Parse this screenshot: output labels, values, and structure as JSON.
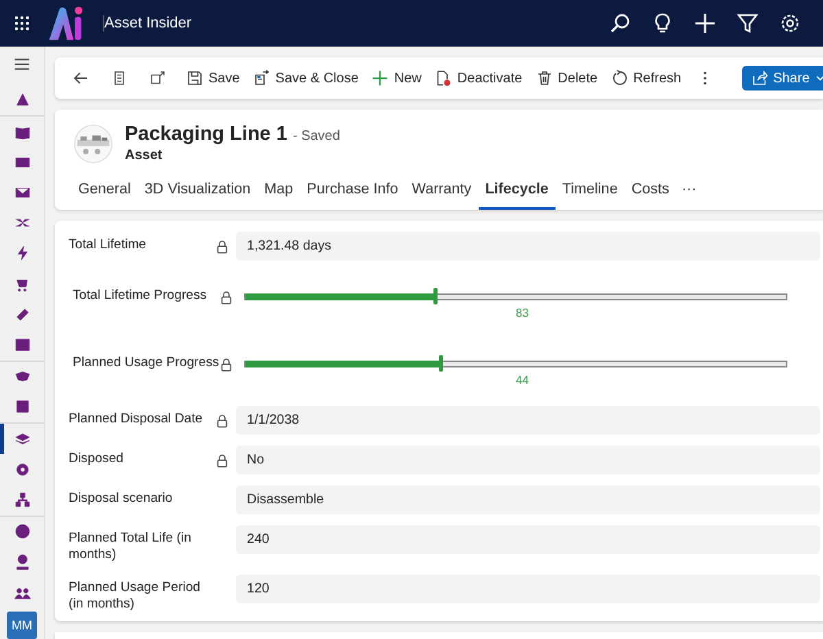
{
  "app": {
    "title": "Asset Insider"
  },
  "sidebar": {
    "items": [
      {
        "selected": false
      },
      {
        "selected": false
      },
      {
        "selected": false
      },
      {
        "selected": false
      },
      {
        "selected": false
      },
      {
        "selected": false
      },
      {
        "selected": false
      },
      {
        "selected": false
      },
      {
        "selected": false
      },
      {
        "selected": false
      },
      {
        "selected": false
      },
      {
        "selected": true
      },
      {
        "selected": false
      },
      {
        "selected": false
      },
      {
        "selected": false
      },
      {
        "selected": false
      },
      {
        "selected": false
      }
    ],
    "user": {
      "initials": "MM"
    }
  },
  "toolbar": {
    "buttons": [
      {
        "kind": "save",
        "label": "Save"
      },
      {
        "kind": "save-close",
        "label": "Save & Close"
      },
      {
        "kind": "new",
        "label": "New"
      },
      {
        "kind": "deactivate",
        "label": "Deactivate"
      },
      {
        "kind": "delete",
        "label": "Delete"
      },
      {
        "kind": "refresh",
        "label": "Refresh"
      }
    ],
    "share": "Share"
  },
  "record": {
    "title": "Packaging Line 1",
    "status": "- Saved",
    "entity": "Asset"
  },
  "tabs": [
    {
      "label": "General",
      "selected": false
    },
    {
      "label": "3D Visualization",
      "selected": false
    },
    {
      "label": "Map",
      "selected": false
    },
    {
      "label": "Purchase Info",
      "selected": false
    },
    {
      "label": "Warranty",
      "selected": false
    },
    {
      "label": "Lifecycle",
      "selected": true
    },
    {
      "label": "Timeline",
      "selected": false
    },
    {
      "label": "Costs",
      "selected": false
    }
  ],
  "tabs_more": "···",
  "fields": [
    {
      "kind": "text",
      "label": "Total Lifetime",
      "locked": true,
      "value": "1,321.48 days"
    },
    {
      "kind": "slider",
      "label": "Total Lifetime Progress",
      "locked": true,
      "level": 0.35,
      "reading": "83"
    },
    {
      "kind": "slider",
      "label": "Planned Usage Progress",
      "locked": true,
      "level": 0.36,
      "reading": "44"
    },
    {
      "kind": "text",
      "label": "Planned Disposal Date",
      "locked": true,
      "value": "1/1/2038"
    },
    {
      "kind": "text",
      "label": "Disposed",
      "locked": true,
      "value": "No"
    },
    {
      "kind": "text",
      "label": "Disposal scenario",
      "locked": false,
      "value": "Disassemble"
    },
    {
      "kind": "text",
      "label": "Planned Total Life (in months)",
      "locked": false,
      "value": "240"
    },
    {
      "kind": "text",
      "label": "Planned Usage Period (in months)",
      "locked": false,
      "value": "120"
    }
  ]
}
